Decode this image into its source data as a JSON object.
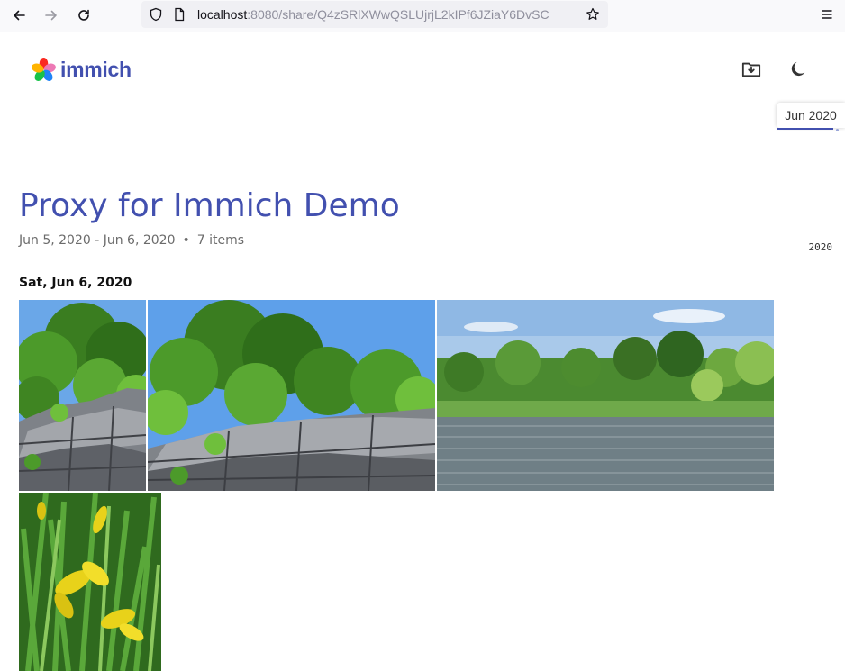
{
  "browser": {
    "url_host": "localhost",
    "url_rest": ":8080/share/Q4zSRlXWwQSLUjrjL2kIPf6JZiaY6DvSC"
  },
  "app": {
    "logo_text": "immich"
  },
  "scrubber": {
    "current_label": "Jun 2020",
    "year_label": "2020"
  },
  "album": {
    "title": "Proxy for Immich Demo",
    "date_range": "Jun 5, 2020 - Jun 6, 2020",
    "separator": "•",
    "item_count": "7 items"
  },
  "groups": [
    {
      "date_label": "Sat, Jun 6, 2020",
      "photos": [
        {
          "subject": "rock-cliff-with-trees"
        },
        {
          "subject": "rock-cliff-with-trees-wide"
        },
        {
          "subject": "lake-with-trees"
        },
        {
          "subject": "yellow-iris-flowers"
        }
      ]
    }
  ],
  "colors": {
    "accent": "#4250af",
    "sky": "#6aa7e8",
    "foliage": "#3c8a22"
  }
}
